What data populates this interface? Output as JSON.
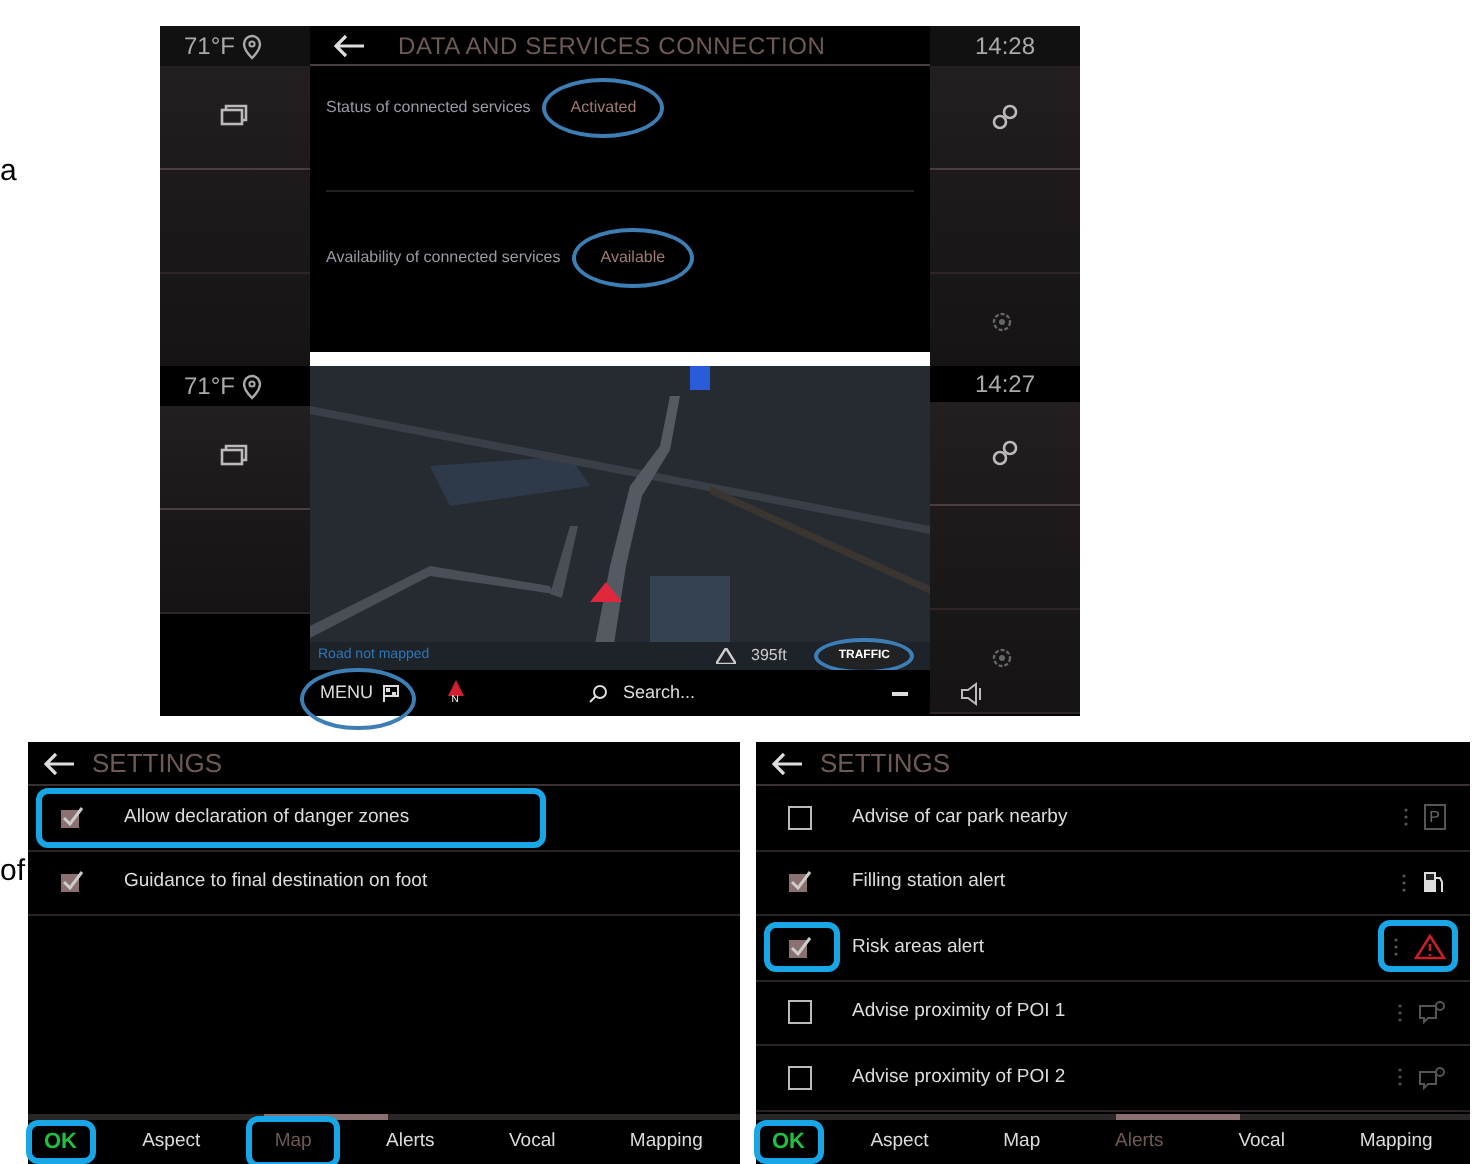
{
  "page_fragments": [
    {
      "text": "a"
    },
    {
      "text": "of"
    }
  ],
  "services_screen": {
    "temperature": "71°F",
    "time": "14:28",
    "title": "DATA AND SERVICES CONNECTION",
    "rows": [
      {
        "label": "Status of connected services",
        "value": "Activated",
        "highlighted": true
      },
      {
        "label": "Availability of connected services",
        "value": "Available",
        "highlighted": true
      }
    ]
  },
  "map_screen": {
    "temperature": "71°F",
    "time": "14:27",
    "road_status": "Road not mapped",
    "elevation": "395ft",
    "traffic_button": {
      "text": "TRAFFIC",
      "highlighted": true
    },
    "menu_button": {
      "text": "MENU",
      "highlighted": true
    },
    "compass": "N",
    "search_placeholder": "Search..."
  },
  "settings_screens": [
    {
      "title": "SETTINGS",
      "ok": {
        "text": "OK",
        "highlighted": true
      },
      "items": [
        {
          "kind": "plain",
          "label": "Allow declaration of danger zones",
          "checked": true,
          "row_highlighted": true,
          "checkbox_highlighted": false
        },
        {
          "kind": "plain",
          "label": "Guidance to final destination on foot",
          "checked": true,
          "row_highlighted": false,
          "checkbox_highlighted": false
        }
      ],
      "tabs": [
        {
          "label": "Aspect",
          "selected": false,
          "highlighted": false
        },
        {
          "label": "Map",
          "selected": true,
          "highlighted": true
        },
        {
          "label": "Alerts",
          "selected": false,
          "highlighted": false
        },
        {
          "label": "Vocal",
          "selected": false,
          "highlighted": false
        },
        {
          "label": "Mapping",
          "selected": false,
          "highlighted": false
        }
      ]
    },
    {
      "title": "SETTINGS",
      "ok": {
        "text": "OK",
        "highlighted": true
      },
      "items": [
        {
          "kind": "parking",
          "badge": "P",
          "label": "Advise of car park nearby",
          "checked": false,
          "row_highlighted": false,
          "checkbox_highlighted": false,
          "icon_highlighted": false
        },
        {
          "kind": "fuel",
          "label": "Filling station alert",
          "checked": true,
          "row_highlighted": false,
          "checkbox_highlighted": false,
          "icon_highlighted": false
        },
        {
          "kind": "warning",
          "label": "Risk areas alert",
          "checked": true,
          "row_highlighted": false,
          "checkbox_highlighted": true,
          "icon_highlighted": true
        },
        {
          "kind": "poi",
          "label": "Advise proximity of POI 1",
          "checked": false,
          "row_highlighted": false,
          "checkbox_highlighted": false,
          "icon_highlighted": false
        },
        {
          "kind": "poi",
          "label": "Advise proximity of POI 2",
          "checked": false,
          "row_highlighted": false,
          "checkbox_highlighted": false,
          "icon_highlighted": false
        }
      ],
      "tabs": [
        {
          "label": "Aspect",
          "selected": false,
          "highlighted": false
        },
        {
          "label": "Map",
          "selected": false,
          "highlighted": false
        },
        {
          "label": "Alerts",
          "selected": true,
          "highlighted": false
        },
        {
          "label": "Vocal",
          "selected": false,
          "highlighted": false
        },
        {
          "label": "Mapping",
          "selected": false,
          "highlighted": false
        }
      ]
    }
  ]
}
